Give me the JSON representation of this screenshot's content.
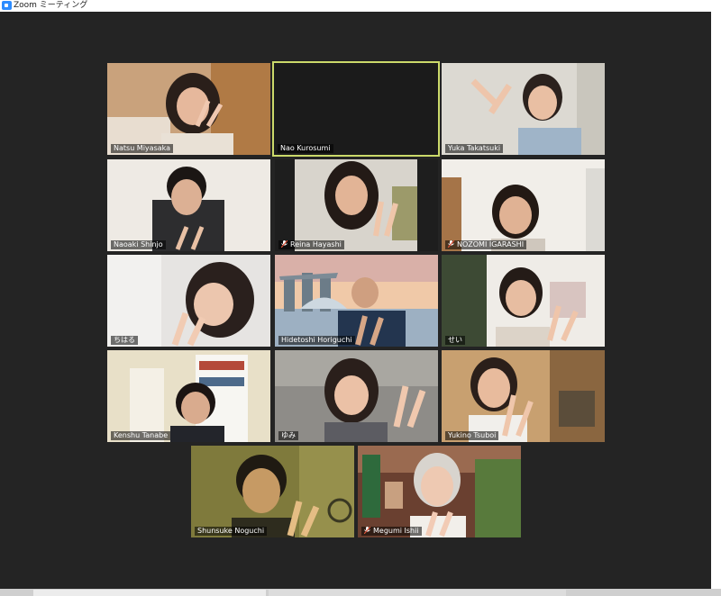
{
  "window": {
    "title": "Zoom ミーティング"
  },
  "accent_colors": {
    "active_speaker_border": "#cbd96a",
    "muted_icon": "#e0553a",
    "background": "#242424"
  },
  "participants": [
    {
      "name": "Natsu Miyasaka",
      "muted": false,
      "active": false
    },
    {
      "name": "Nao Kurosumi",
      "muted": false,
      "active": true
    },
    {
      "name": "Yuka Takatsuki",
      "muted": false,
      "active": false
    },
    {
      "name": "Naoaki Shinjo",
      "muted": false,
      "active": false
    },
    {
      "name": "Reina Hayashi",
      "muted": true,
      "active": false
    },
    {
      "name": "NOZOMI IGARASHI",
      "muted": true,
      "active": false
    },
    {
      "name": "ちはる",
      "muted": false,
      "active": false
    },
    {
      "name": "Hidetoshi Horiguchi",
      "muted": false,
      "active": false
    },
    {
      "name": "せい",
      "muted": false,
      "active": false
    },
    {
      "name": "Kenshu Tanabe",
      "muted": false,
      "active": false
    },
    {
      "name": "ゆみ",
      "muted": false,
      "active": false
    },
    {
      "name": "Yukino Tsuboi",
      "muted": false,
      "active": false
    },
    {
      "name": "Shunsuke Noguchi",
      "muted": false,
      "active": false
    },
    {
      "name": "Megumi Ishii",
      "muted": true,
      "active": false
    }
  ]
}
